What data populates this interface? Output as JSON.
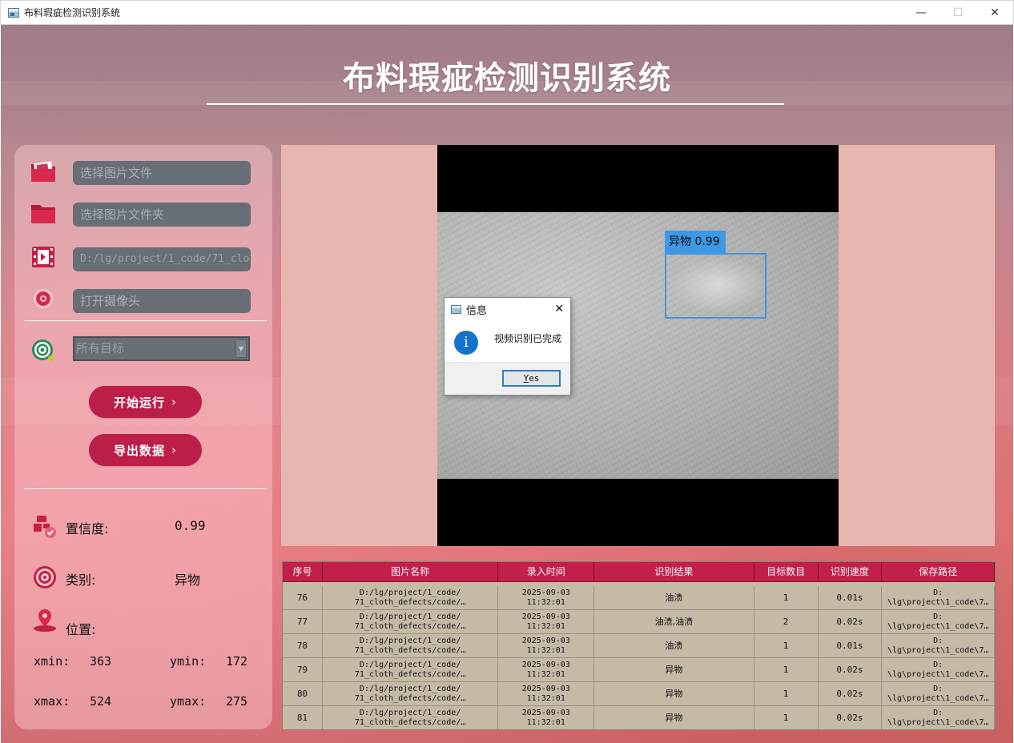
{
  "window": {
    "title": "布料瑕疵检测识别系统",
    "min": "—",
    "max": "☐",
    "close": "✕"
  },
  "header": {
    "title": "布料瑕疵检测识别系统"
  },
  "left_panel": {
    "image_file_placeholder": "选择图片文件",
    "image_folder_placeholder": "选择图片文件夹",
    "video_path_value": "D:/lg/project/1_code/71_clo",
    "camera_placeholder": "打开摄像头",
    "target_select_value": "所有目标",
    "start_button": "开始运行",
    "export_button": "导出数据",
    "confidence_label": "置信度:",
    "confidence_value": "0.99",
    "class_label": "类别:",
    "class_value": "异物",
    "position_label": "位置:",
    "xmin_label": "xmin:",
    "xmin_value": "363",
    "ymin_label": "ymin:",
    "ymin_value": "172",
    "xmax_label": "xmax:",
    "xmax_value": "524",
    "ymax_label": "ymax:",
    "ymax_value": "275"
  },
  "detection": {
    "label": "异物 0.99"
  },
  "dialog": {
    "title": "信息",
    "message": "视频识别已完成",
    "yes_button_prefix": "Y",
    "yes_button_rest": "es",
    "info_glyph": "i",
    "close": "✕"
  },
  "table": {
    "headers": [
      "序号",
      "图片名称",
      "录入时间",
      "识别结果",
      "目标数目",
      "识别速度",
      "保存路径"
    ],
    "rows": [
      {
        "id": "76",
        "name": "D:/lg/project/1_code/\n71_cloth_defects/code/…",
        "time": "2025-09-03\n11:32:01",
        "result": "油渍",
        "count": "1",
        "speed": "0.01s",
        "path": "D:\n\\lg\\project\\1_code\\7…"
      },
      {
        "id": "77",
        "name": "D:/lg/project/1_code/\n71_cloth_defects/code/…",
        "time": "2025-09-03\n11:32:01",
        "result": "油渍,油渍",
        "count": "2",
        "speed": "0.02s",
        "path": "D:\n\\lg\\project\\1_code\\7…"
      },
      {
        "id": "78",
        "name": "D:/lg/project/1_code/\n71_cloth_defects/code/…",
        "time": "2025-09-03\n11:32:01",
        "result": "油渍",
        "count": "1",
        "speed": "0.01s",
        "path": "D:\n\\lg\\project\\1_code\\7…"
      },
      {
        "id": "79",
        "name": "D:/lg/project/1_code/\n71_cloth_defects/code/…",
        "time": "2025-09-03\n11:32:01",
        "result": "异物",
        "count": "1",
        "speed": "0.02s",
        "path": "D:\n\\lg\\project\\1_code\\7…"
      },
      {
        "id": "80",
        "name": "D:/lg/project/1_code/\n71_cloth_defects/code/…",
        "time": "2025-09-03\n11:32:01",
        "result": "异物",
        "count": "1",
        "speed": "0.02s",
        "path": "D:\n\\lg\\project\\1_code\\7…"
      },
      {
        "id": "81",
        "name": "D:/lg/project/1_code/\n71_cloth_defects/code/…",
        "time": "2025-09-03\n11:32:01",
        "result": "异物",
        "count": "1",
        "speed": "0.02s",
        "path": "D:\n\\lg\\project\\1_code\\7…"
      }
    ]
  },
  "colors": {
    "accent": "#bb1f48",
    "box": "#3d98e6",
    "table_bg": "#c5baa6",
    "field_bg": "#686e75"
  }
}
